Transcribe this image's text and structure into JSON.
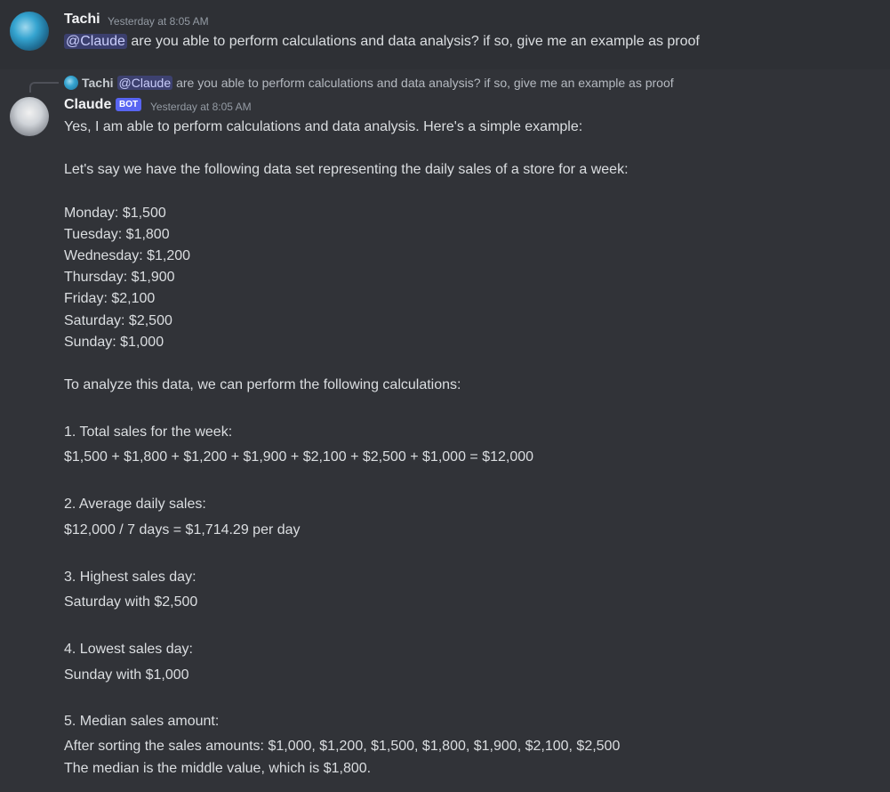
{
  "messages": [
    {
      "author": "Tachi",
      "timestamp": "Yesterday at 8:05 AM",
      "mention": "@Claude",
      "text": "are you able to perform calculations and data analysis? if so, give me an example as proof"
    },
    {
      "author": "Claude",
      "badge": "BOT",
      "timestamp": "Yesterday at 8:05 AM",
      "reply": {
        "author": "Tachi",
        "mention": "@Claude",
        "text": "are you able to perform calculations and data analysis? if so, give me an example as proof"
      },
      "lines": [
        "Yes, I am able to perform calculations and data analysis. Here's a simple example:",
        "Let's say we have the following data set representing the daily sales of a store for a week:",
        "Monday: $1,500",
        "Tuesday: $1,800",
        "Wednesday: $1,200",
        "Thursday: $1,900",
        "Friday: $2,100",
        "Saturday: $2,500",
        "Sunday: $1,000",
        "To analyze this data, we can perform the following calculations:",
        "1. Total sales for the week:",
        "$1,500 + $1,800 + $1,200 + $1,900 + $2,100 + $2,500 + $1,000 = $12,000",
        "2. Average daily sales:",
        "$12,000 / 7 days = $1,714.29 per day",
        "3. Highest sales day:",
        "Saturday with $2,500",
        "4. Lowest sales day:",
        "Sunday with $1,000",
        "5. Median sales amount:",
        "After sorting the sales amounts: $1,000, $1,200, $1,500, $1,800, $1,900, $2,100, $2,500",
        "The median is the middle value, which is $1,800."
      ]
    }
  ],
  "colors": {
    "background": "#313338",
    "hover_background": "#2e3035",
    "text": "#dbdee1",
    "muted": "#949ba4",
    "mention_bg": "#3c4270",
    "bot_badge": "#5865f2"
  }
}
